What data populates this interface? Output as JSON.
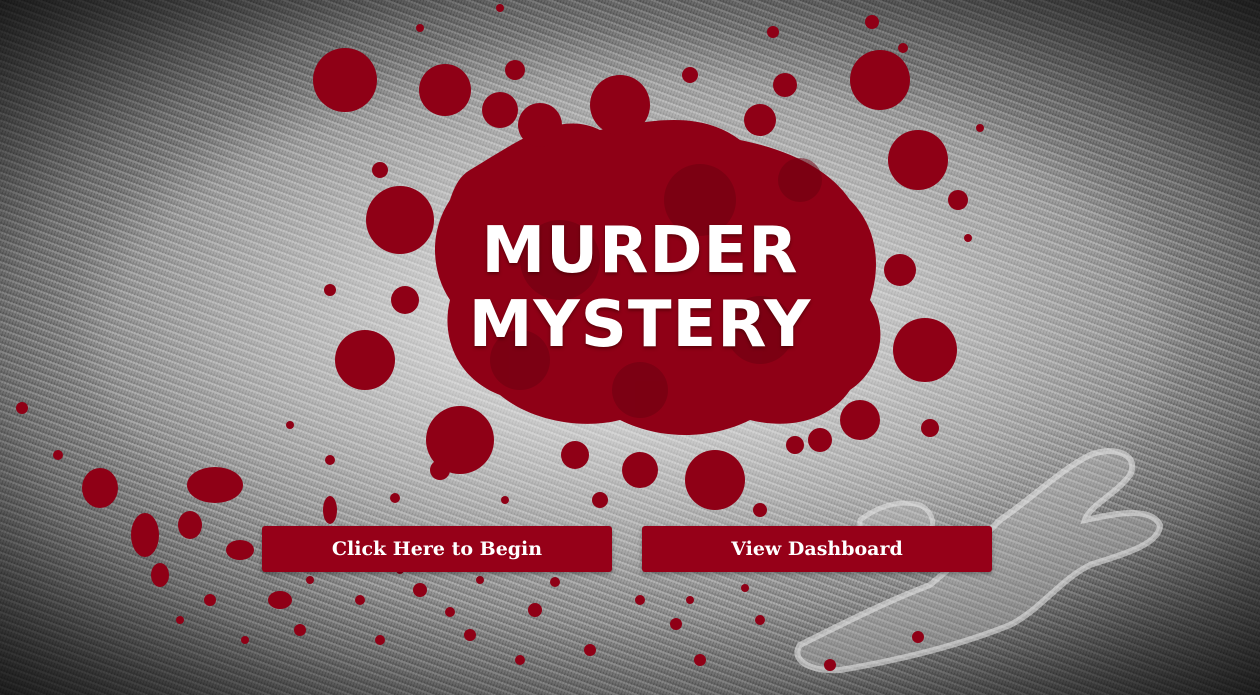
{
  "title": {
    "line1": "MURDER",
    "line2": "MYSTERY"
  },
  "buttons": {
    "begin_label": "Click Here to Begin",
    "dashboard_label": "View Dashboard"
  },
  "colors": {
    "blood": "#8f0016",
    "button": "#960018",
    "button_text": "#ffffff",
    "title_text": "#ffffff"
  },
  "decor": {
    "background": "grey-denim-texture",
    "splatter": "blood-splatter",
    "outline": "chalk-body-outline"
  }
}
